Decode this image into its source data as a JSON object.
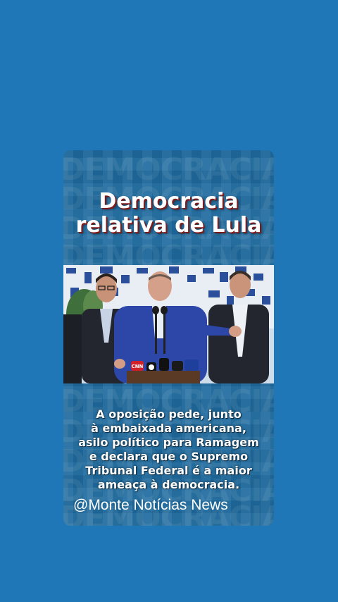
{
  "post": {
    "headline_line1": "Democracia",
    "headline_line2": "relativa de Lula",
    "body_line1": "A oposição pede, junto",
    "body_line2": "à embaixada americana,",
    "body_line3": "asilo político para Ramagem",
    "body_line4": "e declara que o Supremo",
    "body_line5": "Tribunal Federal é a maior",
    "body_line6": "ameaça à democracia.",
    "handle": "@Monte Notícias News",
    "photo_description_icon": "press-conference-photo"
  },
  "colors": {
    "page_background": "#2077b7",
    "card_background": "#1f6b9f",
    "headline_shadow": "#7d1a1a",
    "text": "#ffffff"
  }
}
